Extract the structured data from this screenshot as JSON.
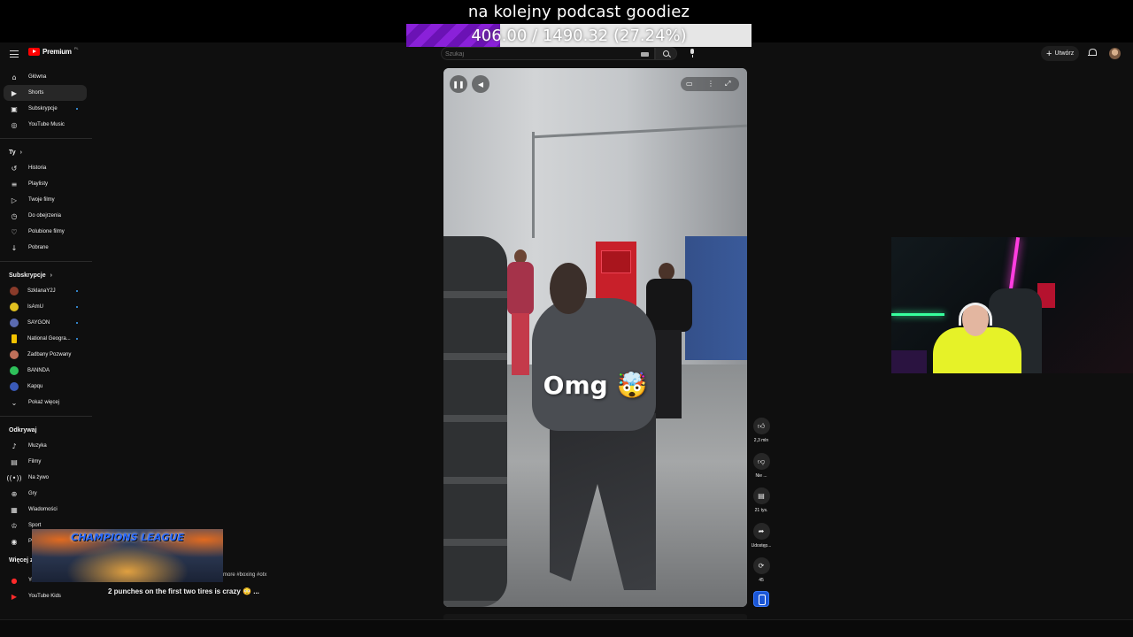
{
  "stream": {
    "title": "na kolejny podcast goodiez",
    "goal_text": "406.00 / 1490.32 (27.24%)",
    "goal_progress": 0.2724
  },
  "header": {
    "logo": "Premium",
    "logo_sup": "PL",
    "search_placeholder": "Szukaj",
    "create_label": "Utwórz"
  },
  "sidebar": {
    "main": [
      {
        "label": "Główna",
        "icon": "home-icon"
      },
      {
        "label": "Shorts",
        "icon": "shorts-icon"
      },
      {
        "label": "Subskrypcje",
        "icon": "subscriptions-icon"
      },
      {
        "label": "YouTube Music",
        "icon": "music-icon"
      }
    ],
    "you_header": "Ty",
    "you": [
      {
        "label": "Historia",
        "icon": "history-icon"
      },
      {
        "label": "Playlisty",
        "icon": "playlists-icon"
      },
      {
        "label": "Twoje filmy",
        "icon": "your-videos-icon"
      },
      {
        "label": "Do obejrzenia",
        "icon": "watch-later-icon"
      },
      {
        "label": "Polubione filmy",
        "icon": "liked-icon"
      },
      {
        "label": "Pobrane",
        "icon": "download-icon"
      }
    ],
    "subs_header": "Subskrypcje",
    "subs": [
      {
        "label": "SzklanaY2J",
        "color": "#8a3b2a"
      },
      {
        "label": "IsAmU",
        "color": "#e0c020"
      },
      {
        "label": "SAYGON",
        "color": "#5a6ab0"
      },
      {
        "label": "National Geogra...",
        "color": "#f2c200"
      },
      {
        "label": "Zadbany Pozwany",
        "color": "#c0705a"
      },
      {
        "label": "BANNDA",
        "color": "#2ec05a"
      },
      {
        "label": "Kapqu",
        "color": "#3a5ab8"
      }
    ],
    "show_more": "Pokaż więcej",
    "explore_header": "Odkrywaj",
    "explore": [
      {
        "label": "Muzyka",
        "icon": "music-note-icon"
      },
      {
        "label": "Filmy",
        "icon": "film-icon"
      },
      {
        "label": "Na żywo",
        "icon": "live-icon"
      },
      {
        "label": "Gry",
        "icon": "gaming-icon"
      },
      {
        "label": "Wiadomości",
        "icon": "news-icon"
      },
      {
        "label": "Sport",
        "icon": "trophy-icon"
      },
      {
        "label": "P",
        "icon": "podcast-icon"
      }
    ],
    "more_header": "Więcej z",
    "more": [
      {
        "label": "YouTube Music"
      },
      {
        "label": "YouTube Kids"
      }
    ]
  },
  "video": {
    "caption": "Omg 🤯",
    "description_line1": "more #boxing #otx",
    "description_line2": "2 punches on the first two tires is crazy 😳 ..."
  },
  "actions": {
    "likes": "2,3 mln",
    "dislike": "Nie ...",
    "comments": "21 tys.",
    "share": "Udostęp...",
    "remix": "45"
  },
  "overlay": {
    "game_title": "CHAMPIONS LEAGUE"
  }
}
